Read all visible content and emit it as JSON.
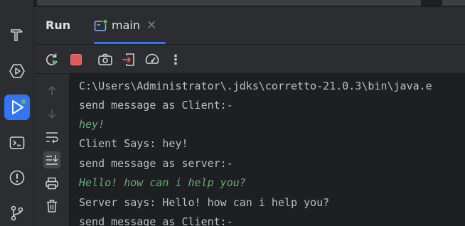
{
  "header": {
    "title": "Run",
    "tab": {
      "label": "main",
      "close": "×"
    }
  },
  "toolstrip": {
    "items": [
      {
        "name": "build-icon"
      },
      {
        "name": "services-icon"
      },
      {
        "name": "run-icon",
        "active": true
      },
      {
        "name": "terminal-icon"
      },
      {
        "name": "problems-icon"
      },
      {
        "name": "git-icon"
      }
    ]
  },
  "toolbar": {
    "more_label": "⋮"
  },
  "console": {
    "lines": [
      "C:\\Users\\Administrator\\.jdks\\corretto-21.0.3\\bin\\java.e",
      "send message as Client:-",
      "hey!",
      "Client Says: hey!",
      "send message as server:-",
      "Hello! how can i help you?",
      "Server says: Hello! how can i help you?",
      "send message as Client:-"
    ]
  },
  "colors": {
    "accent": "#3574f0",
    "user_input": "#6aab73",
    "stop": "#e55b5b",
    "run_green": "#5fb865"
  }
}
